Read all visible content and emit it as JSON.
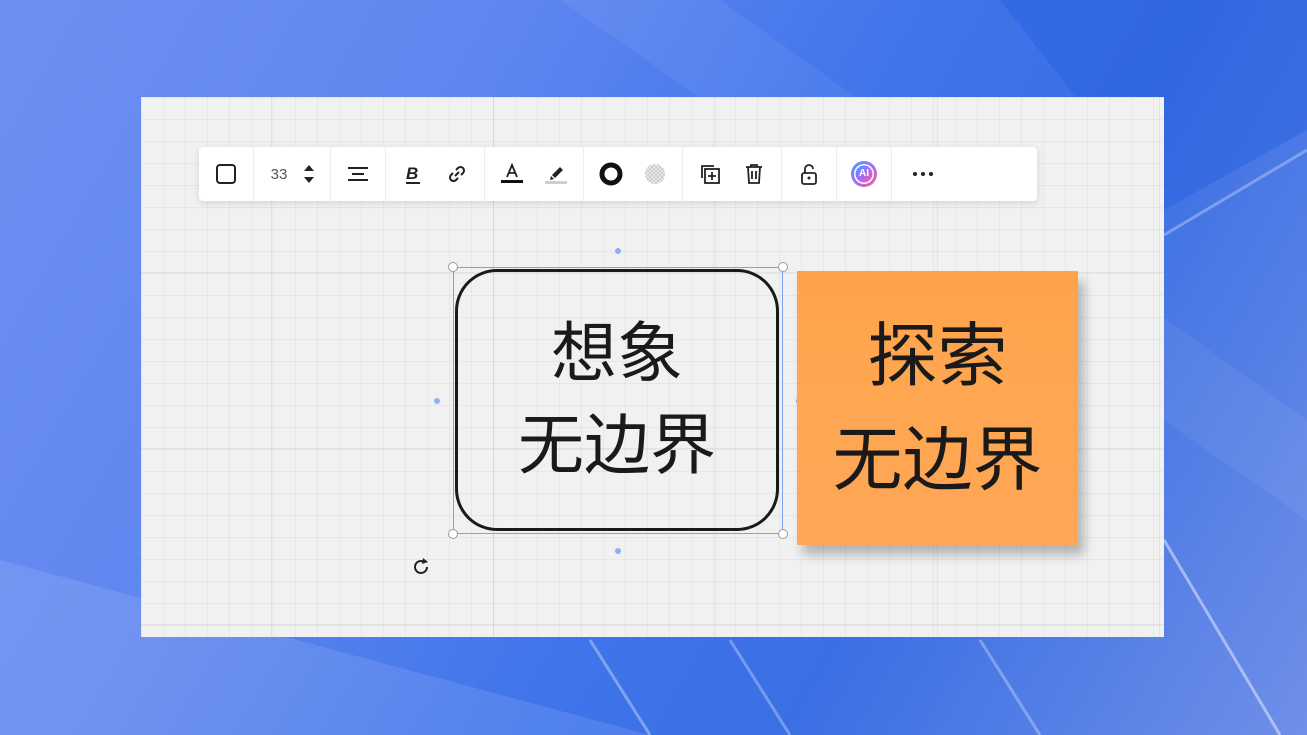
{
  "toolbar": {
    "font_size": "33",
    "ai_label": "AI"
  },
  "shape": {
    "lines": [
      "想象",
      "无边界"
    ]
  },
  "sticky_note": {
    "lines": [
      "探索",
      "无边界"
    ],
    "color": "#ffa550"
  },
  "colors": {
    "background": "#5b84ee",
    "canvas": "#f1f1f2",
    "selection": "#7ba2f2",
    "text": "#1a1a1a"
  }
}
